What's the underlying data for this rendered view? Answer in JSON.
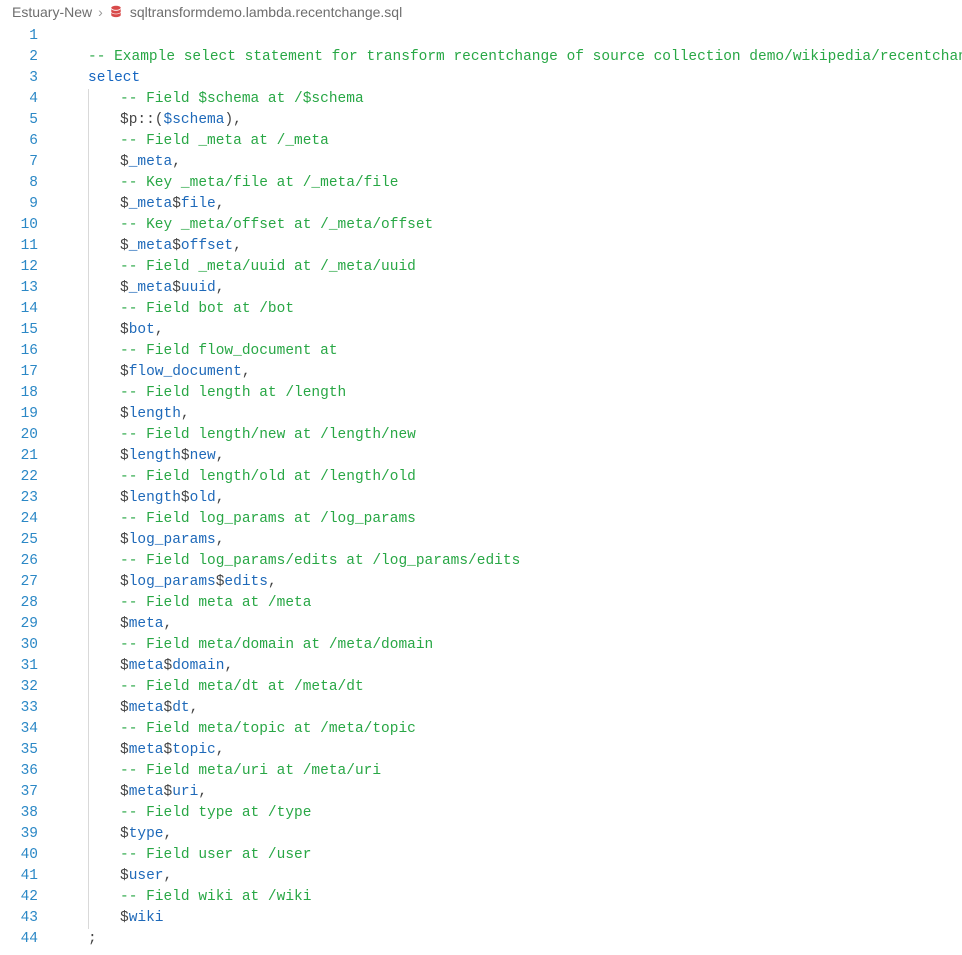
{
  "breadcrumb": {
    "root": "Estuary-New",
    "file": "sqltransformdemo.lambda.recentchange.sql"
  },
  "tokens": {
    "select": "select",
    "semi": ";",
    "dollar": "$",
    "pcol": "p::(",
    "schema": "$schema",
    "close_p_comma": "),",
    "meta_": "_meta",
    "file": "file",
    "offset": "offset",
    "uuid": "uuid",
    "meta": "meta",
    "length": "length",
    "new": "new",
    "old": "old",
    "bot": "bot",
    "flow_document": "flow_document",
    "log_params": "log_params",
    "edits": "edits",
    "domain": "domain",
    "dt": "dt",
    "topic": "topic",
    "uri": "uri",
    "type": "type",
    "user": "user",
    "wiki": "wiki",
    "comma": ","
  },
  "comments": {
    "c1": "-- Example select statement for transform recentchange of source collection demo/wikipedia/recentchange.",
    "c2": "-- Field $schema at /$schema",
    "c3": "-- Field _meta at /_meta",
    "c4": "-- Key _meta/file at /_meta/file",
    "c5": "-- Key _meta/offset at /_meta/offset",
    "c6": "-- Field _meta/uuid at /_meta/uuid",
    "c7": "-- Field bot at /bot",
    "c8": "-- Field flow_document at",
    "c9": "-- Field length at /length",
    "c10": "-- Field length/new at /length/new",
    "c11": "-- Field length/old at /length/old",
    "c12": "-- Field log_params at /log_params",
    "c13": "-- Field log_params/edits at /log_params/edits",
    "c14": "-- Field meta at /meta",
    "c15": "-- Field meta/domain at /meta/domain",
    "c16": "-- Field meta/dt at /meta/dt",
    "c17": "-- Field meta/topic at /meta/topic",
    "c18": "-- Field meta/uri at /meta/uri",
    "c19": "-- Field type at /type",
    "c20": "-- Field user at /user",
    "c21": "-- Field wiki at /wiki"
  }
}
